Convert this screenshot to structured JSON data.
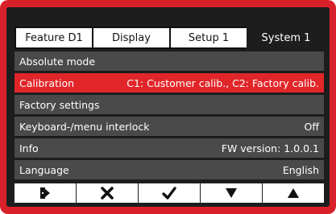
{
  "tabs": [
    {
      "label": "Feature  D1"
    },
    {
      "label": "Display"
    },
    {
      "label": "Setup 1"
    },
    {
      "label": "System 1"
    }
  ],
  "menu": [
    {
      "label": "Absolute mode",
      "value": ""
    },
    {
      "label": "Calibration",
      "value": "C1: Customer calib., C2: Factory calib."
    },
    {
      "label": "Factory settings",
      "value": ""
    },
    {
      "label": "Keyboard-/menu interlock",
      "value": "Off"
    },
    {
      "label": "Info",
      "value": "FW version: 1.0.0.1"
    },
    {
      "label": "Language",
      "value": "English"
    }
  ],
  "softkeys": [
    {
      "icon": "exit-icon"
    },
    {
      "icon": "cancel-x-icon"
    },
    {
      "icon": "confirm-check-icon"
    },
    {
      "icon": "arrow-down-icon"
    },
    {
      "icon": "arrow-up-icon"
    }
  ],
  "colors": {
    "bezel": "#d8202a",
    "screen": "#1d1d1d",
    "row": "#4a4a4a",
    "selected_row": "#e1262a"
  }
}
